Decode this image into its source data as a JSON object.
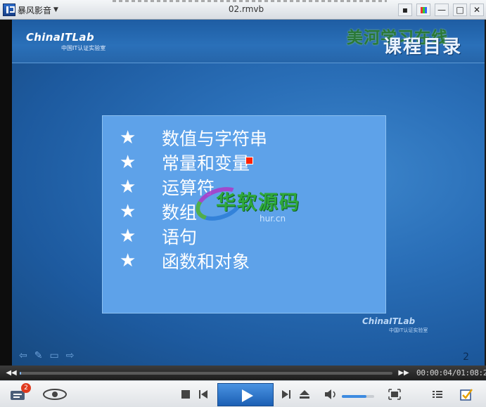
{
  "app": {
    "name": "暴风影音",
    "window_title": "02.rmvb"
  },
  "window_controls": [
    "comment-icon",
    "skin-icon",
    "minimize-icon",
    "maximize-icon",
    "close-icon"
  ],
  "slide": {
    "brand_main": "ChinaITLab",
    "brand_sub": "中国IT认证实验室",
    "course_title": "课程目录",
    "watermark_top": "美河学习在线",
    "bullets": [
      "数值与字符串",
      "常量和变量",
      "运算符",
      "数组",
      "语句",
      "函数和对象"
    ],
    "bullet_symbol": "★",
    "watermark_center": "华软源码",
    "watermark_url": "hur.cn",
    "brand_small": "ChinaITLab",
    "brand_small_sub": "中国IT认证实验室",
    "page_number": "2",
    "colors": {
      "slide_box": "#5ea2e9",
      "background": "#2a6fb8"
    }
  },
  "playback": {
    "time": "00:00:04/01:08:20",
    "progress": 0.001,
    "volume": 0.75
  },
  "controls": {
    "playlist_badge": "2"
  }
}
